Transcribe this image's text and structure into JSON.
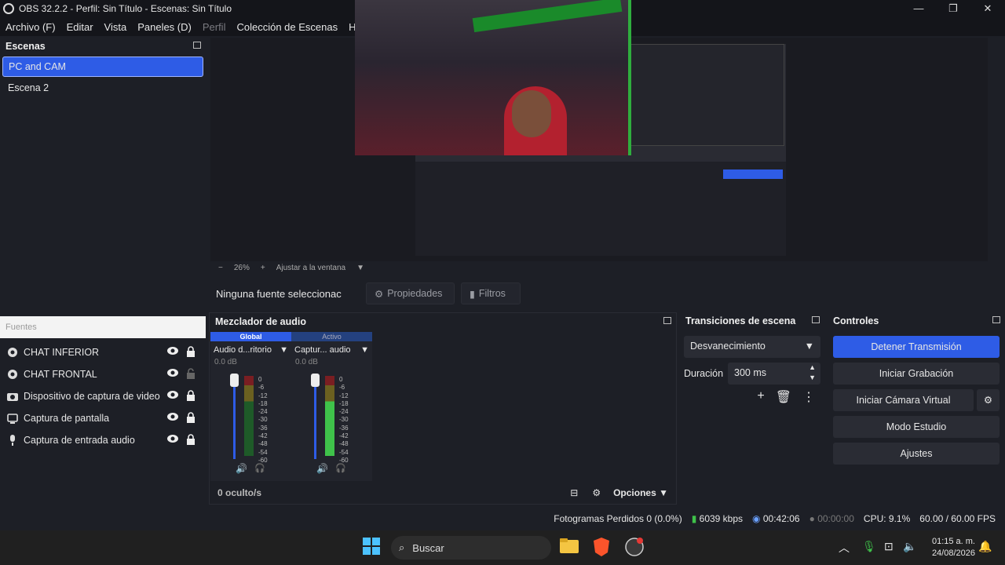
{
  "window": {
    "title": "OBS 32.2.2 - Perfil: Sin Título - Escenas: Sin Título",
    "minimize": "—",
    "maximize": "❐",
    "close": "✕"
  },
  "menu": [
    "Archivo (F)",
    "Editar",
    "Vista",
    "Paneles (D)",
    "Perfil",
    "Colección de Escenas",
    "Herra"
  ],
  "scenes": {
    "title": "Escenas",
    "items": [
      "PC and CAM",
      "Escena 2"
    ],
    "selected": "PC and CAM"
  },
  "preview": {
    "zoom": "26%",
    "fit_label": "Ajustar a la ventana"
  },
  "source_bar": {
    "no_source": "Ninguna fuente seleccionac",
    "properties": "Propiedades",
    "filters": "Filtros"
  },
  "sources": {
    "title": "Fuentes",
    "items": [
      {
        "label": "CHAT INFERIOR",
        "icon": "browser-icon"
      },
      {
        "label": "CHAT FRONTAL",
        "icon": "browser-icon"
      },
      {
        "label": "Dispositivo de captura de video",
        "icon": "camera-icon"
      },
      {
        "label": "Captura de pantalla",
        "icon": "monitor-icon"
      },
      {
        "label": "Captura de entrada audio",
        "icon": "mic-icon"
      }
    ]
  },
  "mixer": {
    "title": "Mezclador de audio",
    "tabs": [
      "Global",
      "Activo"
    ],
    "channels": [
      {
        "name": "Audio d...ritorio",
        "db": "0.0 dB"
      },
      {
        "name": "Captur... audio",
        "db": "0.0 dB"
      }
    ],
    "scale": [
      "0",
      "-6",
      "-12",
      "-18",
      "-24",
      "-30",
      "-36",
      "-42",
      "-48",
      "-54",
      "-60"
    ],
    "hidden": "0 oculto/s",
    "options": "Opciones"
  },
  "transitions": {
    "title": "Transiciones de escena",
    "selected": "Desvanecimiento",
    "duration_label": "Duración",
    "duration_value": "300 ms"
  },
  "controls": {
    "title": "Controles",
    "buttons": [
      "Detener Transmisión",
      "Iniciar Grabación",
      "Iniciar Cámara Virtual",
      "Modo Estudio",
      "Ajustes"
    ]
  },
  "status": {
    "dropped": "Fotogramas Perdidos 0 (0.0%)",
    "bitrate": "6039 kbps",
    "stream_time": "00:42:06",
    "rec_time": "00:00:00",
    "cpu": "CPU: 9.1%",
    "fps": "60.00 / 60.00 FPS"
  },
  "taskbar": {
    "search": "Buscar",
    "time": "01:15 a. m.",
    "date": "24/08/2026"
  },
  "colors": {
    "accent": "#2e5ce6",
    "bg": "#1d1f26",
    "panel": "#2a2c34"
  }
}
